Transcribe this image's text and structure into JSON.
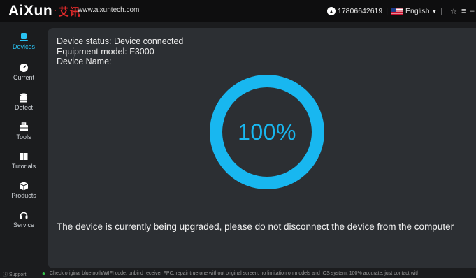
{
  "header": {
    "logo_text": "AiXun",
    "logo_dot": "·",
    "logo_cn": "艾讯",
    "website": "www.aixuntech.com",
    "account": "17806642619",
    "language": "English"
  },
  "sidebar": {
    "items": [
      {
        "label": "Devices",
        "icon": "devices-icon"
      },
      {
        "label": "Current",
        "icon": "gauge-icon"
      },
      {
        "label": "Detect",
        "icon": "database-icon"
      },
      {
        "label": "Tools",
        "icon": "toolbox-icon"
      },
      {
        "label": "Tutorials",
        "icon": "book-icon"
      },
      {
        "label": "Products",
        "icon": "box-icon"
      },
      {
        "label": "Service",
        "icon": "headset-icon"
      }
    ]
  },
  "main": {
    "device_status": "Device status: Device connected",
    "equipment_model": "Equipment model: F3000",
    "device_name": "Device Name:",
    "progress_text": "100%",
    "progress": 1.0,
    "message": "The device is currently being upgraded, please do not disconnect the device from the computer"
  },
  "footer": {
    "support": "Support",
    "promo": "Check original bluetooth/WIFI code, unbind receiver FPC, repair truetone without original screen, no limitation on models and IOS system, 100% accurate, just contact with"
  },
  "colors": {
    "accent": "#29c2f2",
    "ring": "#18b7f0",
    "panel": "#2c2f33",
    "background": "#1b1c1e",
    "brand_red": "#e02a2a"
  }
}
